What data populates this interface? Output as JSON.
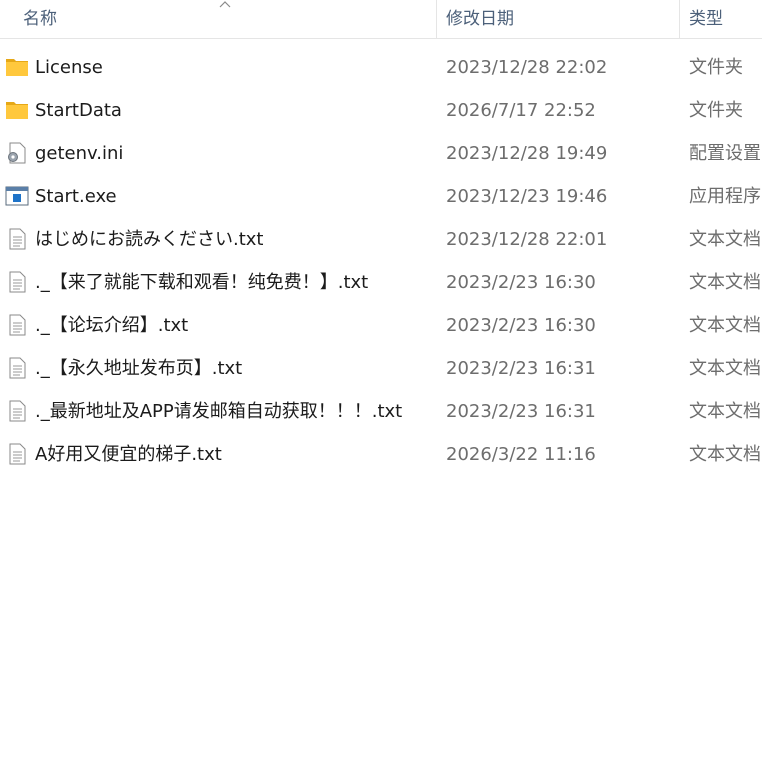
{
  "columns": {
    "name": "名称",
    "date": "修改日期",
    "type": "类型"
  },
  "files": [
    {
      "name": "License",
      "date": "2023/12/28 22:02",
      "type": "文件夹",
      "icon": "folder-icon"
    },
    {
      "name": "StartData",
      "date": "2026/7/17 22:52",
      "type": "文件夹",
      "icon": "folder-icon"
    },
    {
      "name": "getenv.ini",
      "date": "2023/12/28 19:49",
      "type": "配置设置",
      "icon": "config-file-icon"
    },
    {
      "name": "Start.exe",
      "date": "2023/12/23 19:46",
      "type": "应用程序",
      "icon": "application-icon"
    },
    {
      "name": "はじめにお読みください.txt",
      "date": "2023/12/28 22:01",
      "type": "文本文档",
      "icon": "text-file-icon"
    },
    {
      "name": "._【来了就能下载和观看！纯免费！】.txt",
      "date": "2023/2/23 16:30",
      "type": "文本文档",
      "icon": "text-file-icon"
    },
    {
      "name": "._【论坛介绍】.txt",
      "date": "2023/2/23 16:30",
      "type": "文本文档",
      "icon": "text-file-icon"
    },
    {
      "name": "._【永久地址发布页】.txt",
      "date": "2023/2/23 16:31",
      "type": "文本文档",
      "icon": "text-file-icon"
    },
    {
      "name": "._最新地址及APP请发邮箱自动获取！！！.txt",
      "date": "2023/2/23 16:31",
      "type": "文本文档",
      "icon": "text-file-icon"
    },
    {
      "name": "A好用又便宜的梯子.txt",
      "date": "2026/3/22 11:16",
      "type": "文本文档",
      "icon": "text-file-icon"
    }
  ],
  "colors": {
    "header_text": "#4c607a",
    "name_text": "#1b1b1b",
    "secondary_text": "#6d6d6d",
    "folder_yellow": "#ffc83d",
    "exe_blue": "#1e73c8"
  }
}
